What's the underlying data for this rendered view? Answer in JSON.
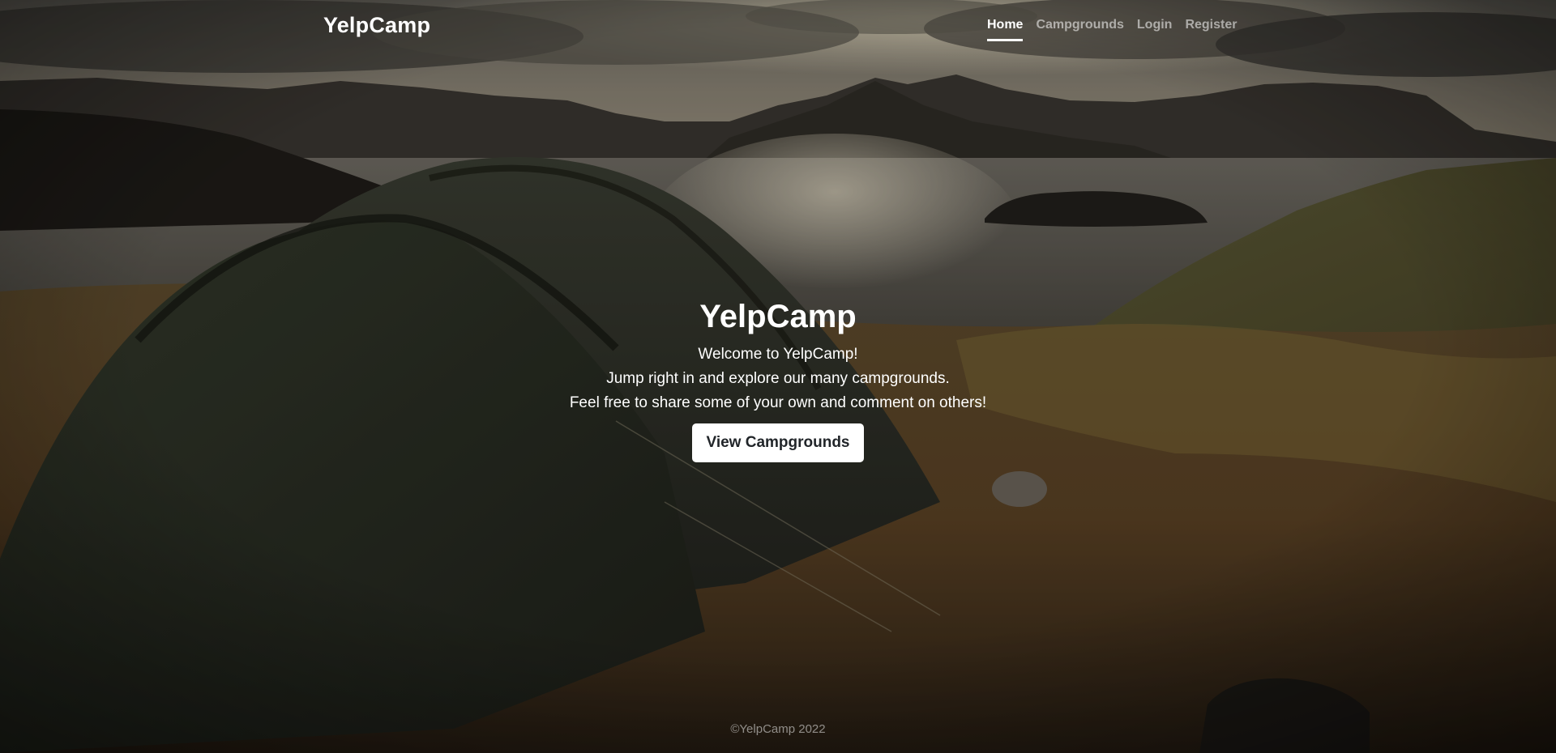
{
  "navbar": {
    "brand": "YelpCamp",
    "links": [
      {
        "label": "Home",
        "active": true
      },
      {
        "label": "Campgrounds",
        "active": false
      },
      {
        "label": "Login",
        "active": false
      },
      {
        "label": "Register",
        "active": false
      }
    ]
  },
  "hero": {
    "title": "YelpCamp",
    "lines": [
      "Welcome to YelpCamp!",
      "Jump right in and explore our many campgrounds.",
      "Feel free to share some of your own and comment on others!"
    ],
    "button_label": "View Campgrounds"
  },
  "footer": {
    "copyright": "©YelpCamp 2022"
  },
  "colors": {
    "button_bg": "#ffffff",
    "button_text": "#212529",
    "nav_active": "#ffffff",
    "nav_inactive": "rgba(255,255,255,0.55)"
  }
}
